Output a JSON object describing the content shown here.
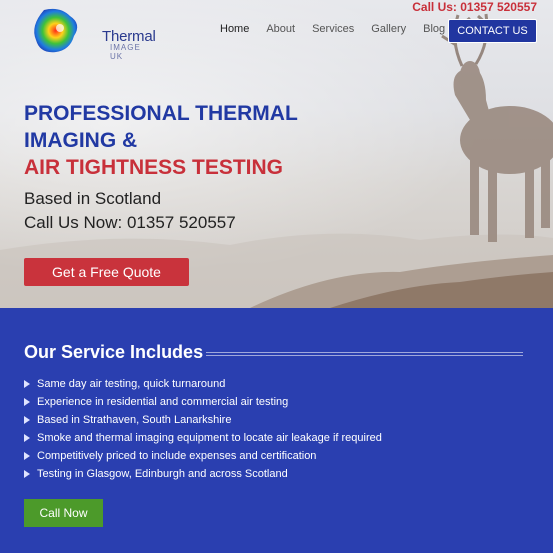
{
  "header": {
    "call_top": "Call Us: 01357 520557",
    "logo_word": "Thermal",
    "logo_sub": "IMAGE UK"
  },
  "nav": {
    "items": [
      {
        "label": "Home",
        "active": true
      },
      {
        "label": "About"
      },
      {
        "label": "Services"
      },
      {
        "label": "Gallery"
      },
      {
        "label": "Blog"
      }
    ],
    "contact_label": "CONTACT US"
  },
  "hero": {
    "line1": "PROFESSIONAL THERMAL",
    "line2": "IMAGING &",
    "line3": "AIR TIGHTNESS TESTING",
    "based": "Based in Scotland",
    "call": "Call Us Now: 01357 520557",
    "quote_label": "Get a Free Quote"
  },
  "services": {
    "title": "Our Service Includes",
    "items": [
      "Same day air testing, quick turnaround",
      "Experience in residential and commercial air testing",
      "Based in Strathaven, South Lanarkshire",
      "Smoke and thermal imaging equipment to locate air leakage if required",
      "Competitively priced to include expenses and certification",
      "Testing in Glasgow, Edinburgh and across Scotland"
    ],
    "call_now_label": "Call Now"
  },
  "colors": {
    "brand_blue": "#2136a0",
    "accent_red": "#c8303a",
    "services_bg": "#2a3fb0",
    "call_green": "#4c9a2a"
  }
}
